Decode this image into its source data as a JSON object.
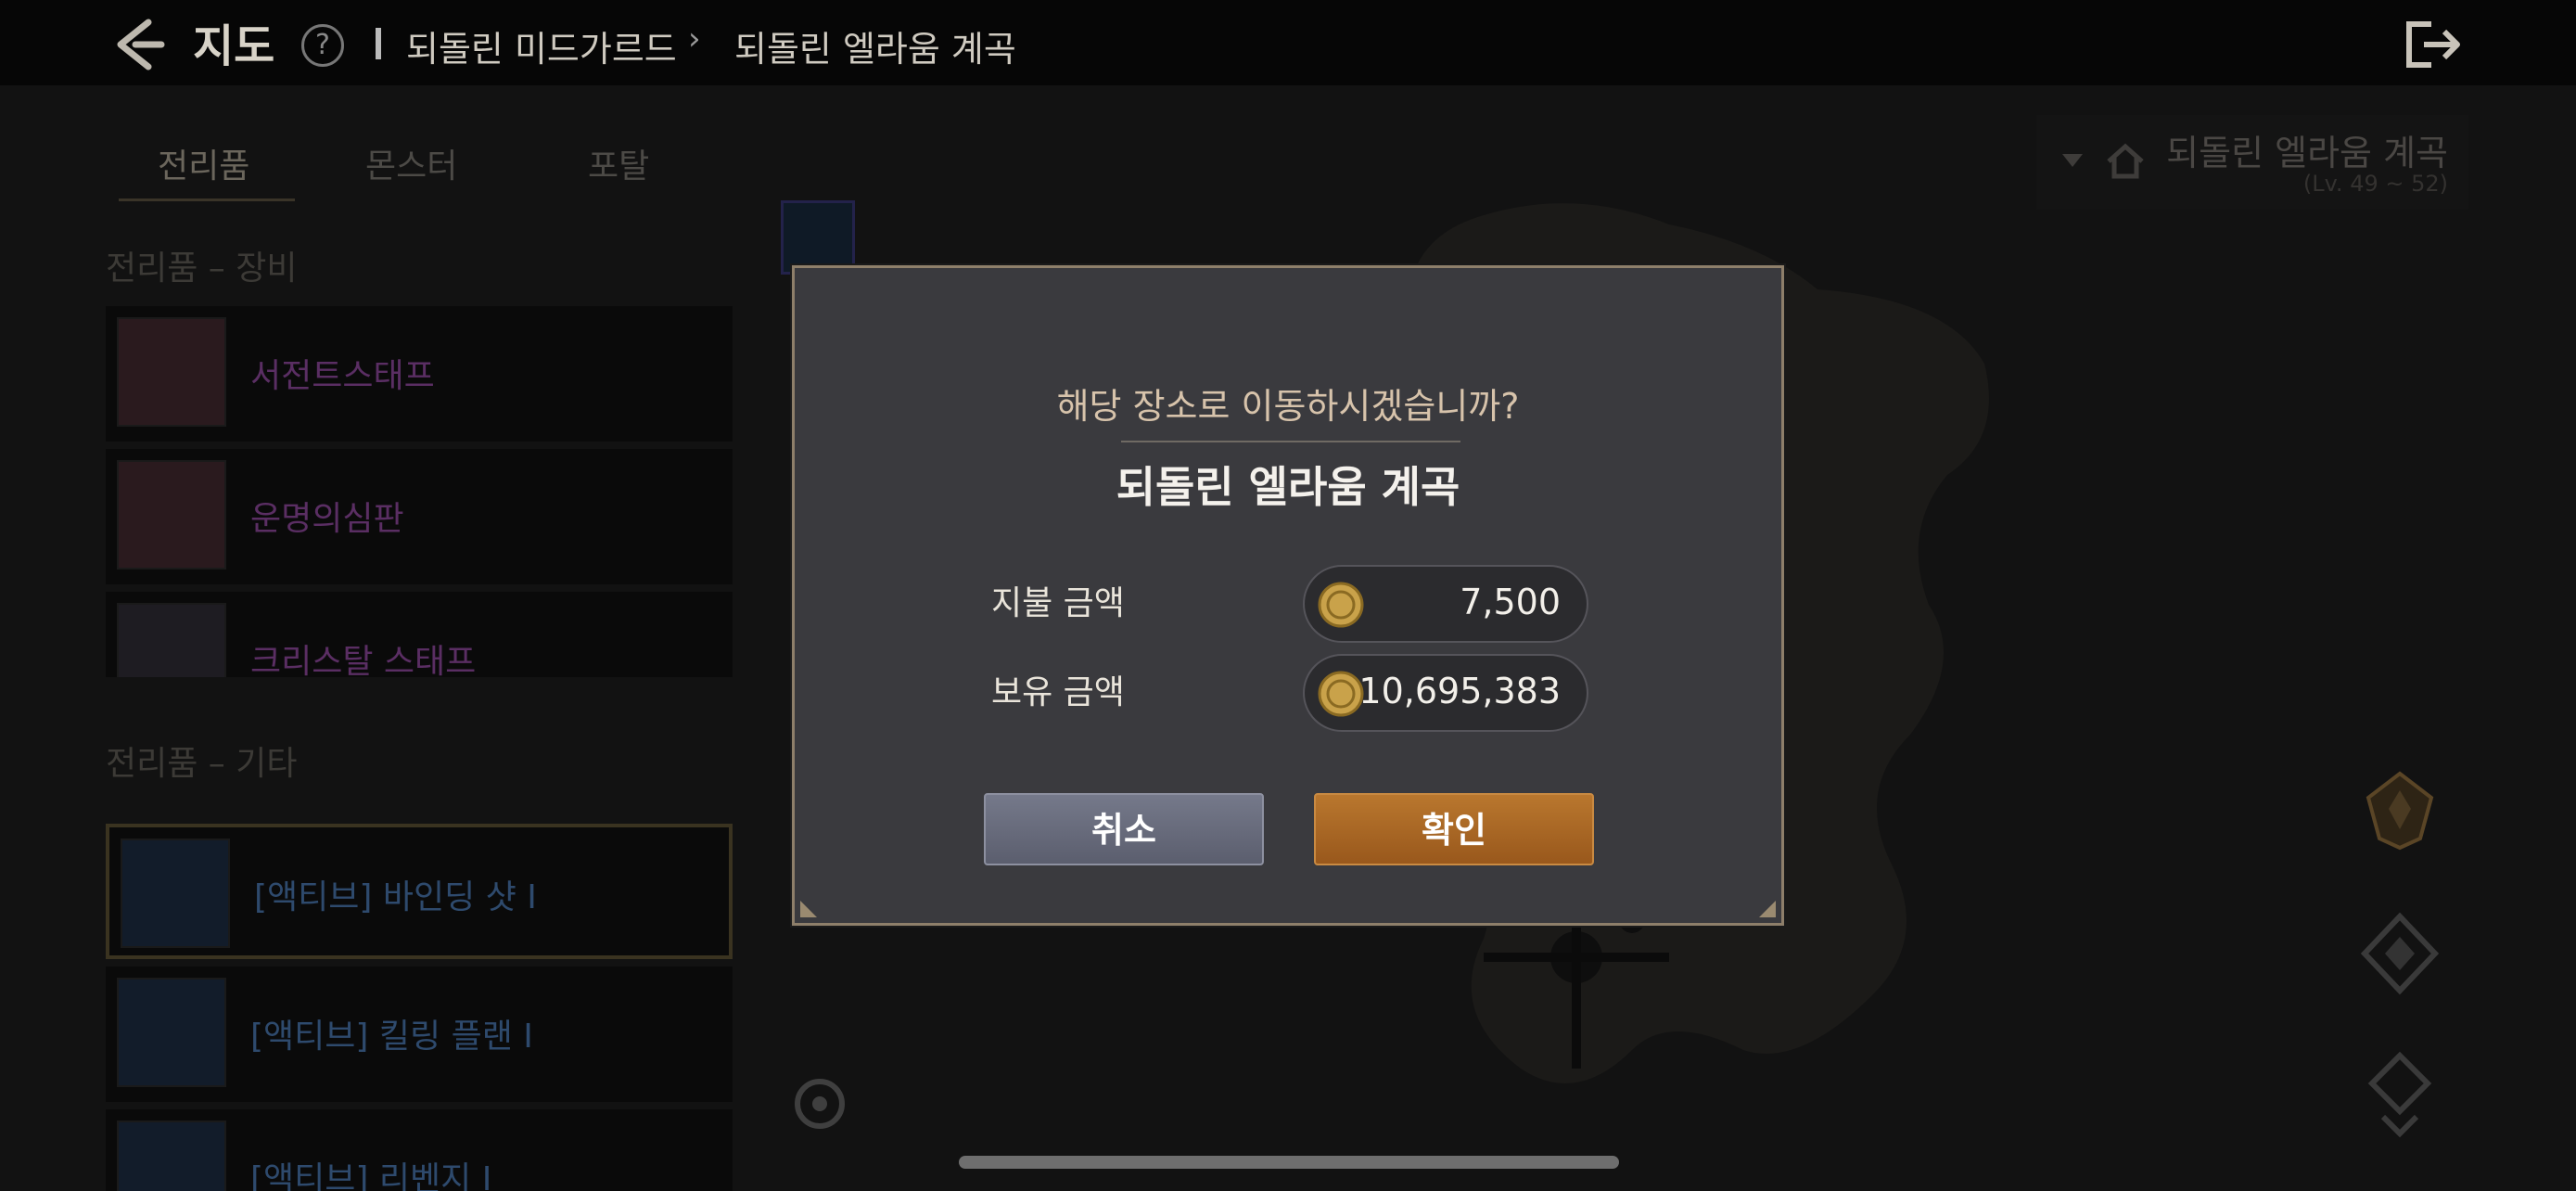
{
  "topbar": {
    "title": "지도",
    "help_glyph": "?",
    "breadcrumb_parent": "되돌린 미드가르드",
    "breadcrumb_current": "되돌린 엘라움 계곡",
    "icons": [
      "back-arrow-icon",
      "help-icon",
      "exit-icon"
    ]
  },
  "left_panel": {
    "tabs": [
      {
        "label": "전리품",
        "active": true
      },
      {
        "label": "몬스터",
        "active": false
      },
      {
        "label": "포탈",
        "active": false
      }
    ],
    "equipment_section_title": "전리품 – 장비",
    "equipment_items": [
      {
        "name": "서전트스태프",
        "color": "#5a2e63"
      },
      {
        "name": "운명의심판",
        "color": "#5a2e63"
      },
      {
        "name": "크리스탈 스태프",
        "color": "#5a2e63"
      }
    ],
    "other_section_title": "전리품 – 기타",
    "other_items": [
      {
        "name": "[액티브] 바인딩 샷 I",
        "color": "#2e4a6d",
        "selected": true
      },
      {
        "name": "[액티브] 킬링 플랜 I",
        "color": "#2e4a6d",
        "selected": false
      },
      {
        "name": "[액티브] 리벤지 I",
        "color": "#2e4a6d",
        "selected": false
      }
    ]
  },
  "region": {
    "name": "되돌린 엘라움 계곡",
    "level": "(Lv. 49 ~ 52)"
  },
  "dialog": {
    "question": "해당 장소로 이동하시겠습니까?",
    "destination": "되돌린 엘라움 계곡",
    "pay_label": "지불 금액",
    "pay_amount": "7,500",
    "hold_label": "보유 금액",
    "hold_amount": "10,695,383",
    "cancel_label": "취소",
    "confirm_label": "확인"
  },
  "colors": {
    "accent_gold": "#b9772e",
    "dialog_bg": "#3a3a3e",
    "dialog_border": "#8e7f6a",
    "cancel_button": "#6a6d7d"
  }
}
